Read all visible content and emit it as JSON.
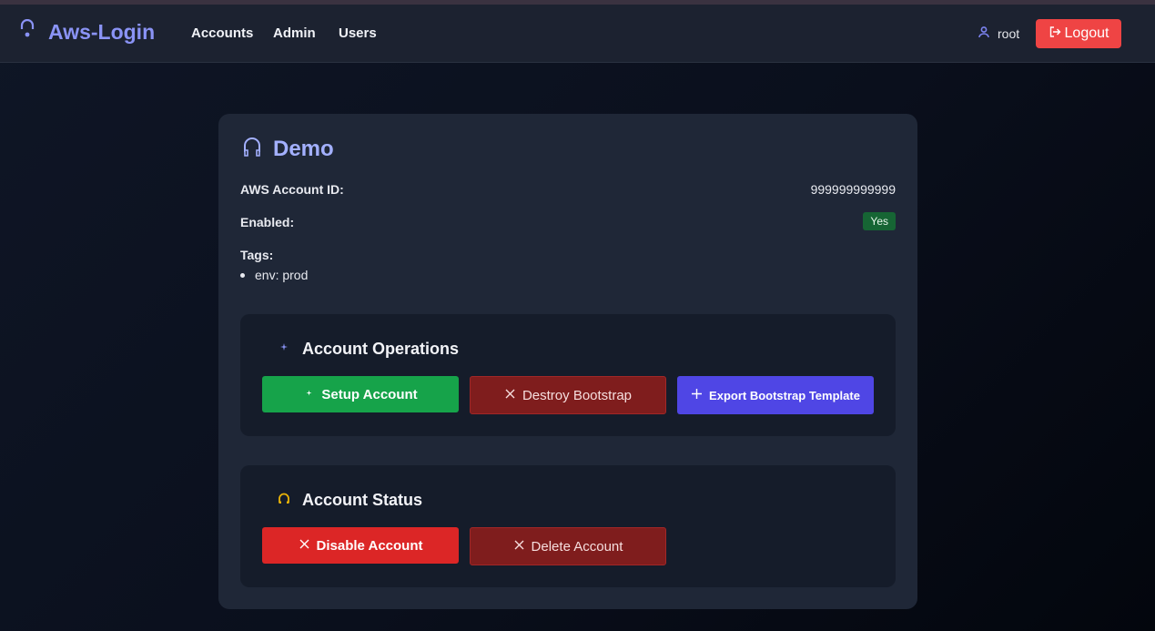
{
  "navbar": {
    "brand": "Aws-Login",
    "links": [
      "Accounts",
      "Admin",
      "Users"
    ],
    "user": "root",
    "logout_label": "Logout"
  },
  "account": {
    "name": "Demo",
    "aws_id_label": "AWS Account ID:",
    "aws_id_value": "999999999999",
    "enabled_label": "Enabled:",
    "enabled_value": "Yes",
    "tags_label": "Tags:",
    "tags": [
      "env: prod"
    ]
  },
  "operations": {
    "title": "Account Operations",
    "setup_label": "Setup Account",
    "destroy_label": "Destroy Bootstrap",
    "export_label": "Export Bootstrap Template"
  },
  "status": {
    "title": "Account Status",
    "disable_label": "Disable Account",
    "delete_label": "Delete Account"
  },
  "colors": {
    "brand": "#8a93f5",
    "success": "#16a34a",
    "danger": "#dc2626",
    "danger_dark": "#7f1d1d",
    "primary": "#4f46e5",
    "logout": "#ef4444"
  }
}
